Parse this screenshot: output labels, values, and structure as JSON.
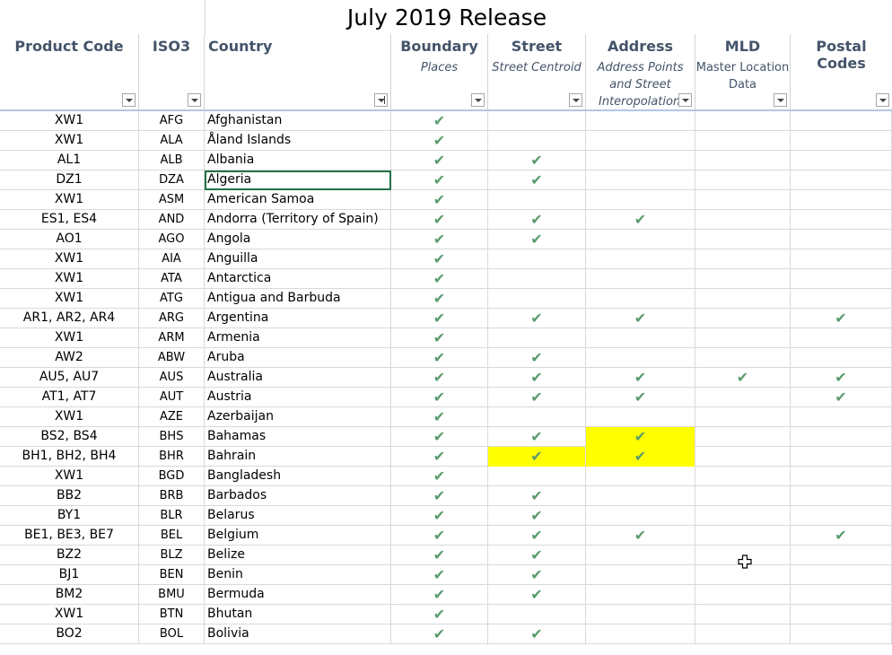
{
  "title": "July 2019 Release",
  "headers": {
    "product_code": "Product Code",
    "iso3": "ISO3",
    "country": "Country",
    "boundary": "Boundary",
    "boundary_sub": "Places",
    "street": "Street",
    "street_sub": "Street Centroid",
    "address": "Address",
    "address_sub1": "Address Points",
    "address_sub2": "and Street",
    "address_sub3": "Interopolation",
    "mld": "MLD",
    "mld_sub1": "Master Location",
    "mld_sub2": "Data",
    "postal": "Postal Codes"
  },
  "check_symbol": "✔",
  "highlight_color": "#ffff00",
  "rows": [
    {
      "code": "XW1",
      "iso": "AFG",
      "country": "Afghanistan",
      "b": true,
      "s": false,
      "a": false,
      "m": false,
      "p": false
    },
    {
      "code": "XW1",
      "iso": "ALA",
      "country": "Åland Islands",
      "b": true,
      "s": false,
      "a": false,
      "m": false,
      "p": false
    },
    {
      "code": "AL1",
      "iso": "ALB",
      "country": "Albania",
      "b": true,
      "s": true,
      "a": false,
      "m": false,
      "p": false
    },
    {
      "code": "DZ1",
      "iso": "DZA",
      "country": "Algeria",
      "b": true,
      "s": true,
      "a": false,
      "m": false,
      "p": false,
      "selected": true
    },
    {
      "code": "XW1",
      "iso": "ASM",
      "country": "American Samoa",
      "b": true,
      "s": false,
      "a": false,
      "m": false,
      "p": false
    },
    {
      "code": "ES1, ES4",
      "iso": "AND",
      "country": "Andorra (Territory of Spain)",
      "b": true,
      "s": true,
      "a": true,
      "m": false,
      "p": false
    },
    {
      "code": "AO1",
      "iso": "AGO",
      "country": "Angola",
      "b": true,
      "s": true,
      "a": false,
      "m": false,
      "p": false
    },
    {
      "code": "XW1",
      "iso": "AIA",
      "country": "Anguilla",
      "b": true,
      "s": false,
      "a": false,
      "m": false,
      "p": false
    },
    {
      "code": "XW1",
      "iso": "ATA",
      "country": "Antarctica",
      "b": true,
      "s": false,
      "a": false,
      "m": false,
      "p": false
    },
    {
      "code": "XW1",
      "iso": "ATG",
      "country": "Antigua and Barbuda",
      "b": true,
      "s": false,
      "a": false,
      "m": false,
      "p": false
    },
    {
      "code": "AR1, AR2, AR4",
      "iso": "ARG",
      "country": "Argentina",
      "b": true,
      "s": true,
      "a": true,
      "m": false,
      "p": true
    },
    {
      "code": "XW1",
      "iso": "ARM",
      "country": "Armenia",
      "b": true,
      "s": false,
      "a": false,
      "m": false,
      "p": false
    },
    {
      "code": "AW2",
      "iso": "ABW",
      "country": "Aruba",
      "b": true,
      "s": true,
      "a": false,
      "m": false,
      "p": false
    },
    {
      "code": "AU5, AU7",
      "iso": "AUS",
      "country": "Australia",
      "b": true,
      "s": true,
      "a": true,
      "m": true,
      "p": true
    },
    {
      "code": "AT1, AT7",
      "iso": "AUT",
      "country": "Austria",
      "b": true,
      "s": true,
      "a": true,
      "m": false,
      "p": true
    },
    {
      "code": "XW1",
      "iso": "AZE",
      "country": "Azerbaijan",
      "b": true,
      "s": false,
      "a": false,
      "m": false,
      "p": false
    },
    {
      "code": "BS2, BS4",
      "iso": "BHS",
      "country": "Bahamas",
      "b": true,
      "s": true,
      "a": true,
      "m": false,
      "p": false,
      "hl_a": true
    },
    {
      "code": "BH1, BH2, BH4",
      "iso": "BHR",
      "country": "Bahrain",
      "b": true,
      "s": true,
      "a": true,
      "m": false,
      "p": false,
      "hl_s": true,
      "hl_a": true
    },
    {
      "code": "XW1",
      "iso": "BGD",
      "country": "Bangladesh",
      "b": true,
      "s": false,
      "a": false,
      "m": false,
      "p": false
    },
    {
      "code": "BB2",
      "iso": "BRB",
      "country": "Barbados",
      "b": true,
      "s": true,
      "a": false,
      "m": false,
      "p": false
    },
    {
      "code": "BY1",
      "iso": "BLR",
      "country": "Belarus",
      "b": true,
      "s": true,
      "a": false,
      "m": false,
      "p": false
    },
    {
      "code": "BE1, BE3, BE7",
      "iso": "BEL",
      "country": "Belgium",
      "b": true,
      "s": true,
      "a": true,
      "m": false,
      "p": true
    },
    {
      "code": "BZ2",
      "iso": "BLZ",
      "country": "Belize",
      "b": true,
      "s": true,
      "a": false,
      "m": false,
      "p": false
    },
    {
      "code": "BJ1",
      "iso": "BEN",
      "country": "Benin",
      "b": true,
      "s": true,
      "a": false,
      "m": false,
      "p": false
    },
    {
      "code": "BM2",
      "iso": "BMU",
      "country": "Bermuda",
      "b": true,
      "s": true,
      "a": false,
      "m": false,
      "p": false
    },
    {
      "code": "XW1",
      "iso": "BTN",
      "country": "Bhutan",
      "b": true,
      "s": false,
      "a": false,
      "m": false,
      "p": false
    },
    {
      "code": "BO2",
      "iso": "BOL",
      "country": "Bolivia",
      "b": true,
      "s": true,
      "a": false,
      "m": false,
      "p": false
    }
  ]
}
